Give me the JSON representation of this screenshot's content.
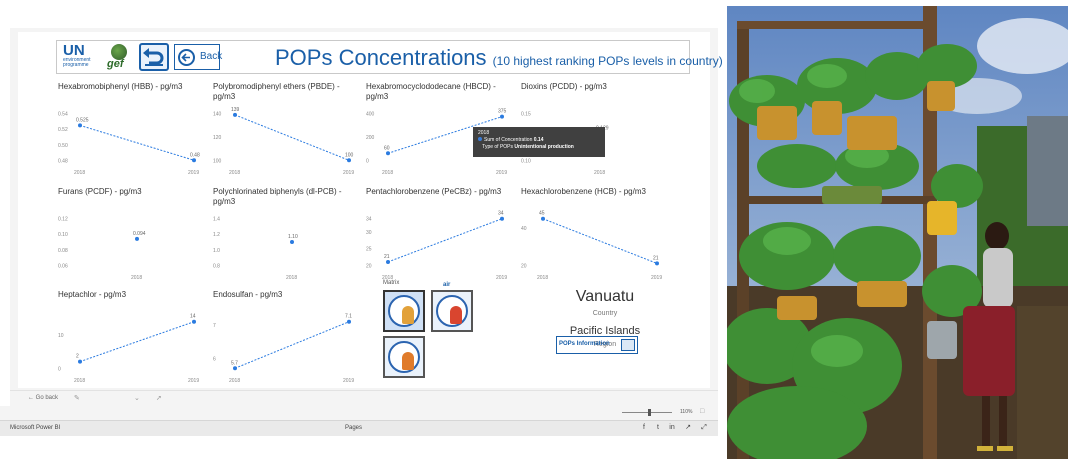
{
  "header": {
    "logo_un": "UN",
    "logo_un_sub1": "environment",
    "logo_un_sub2": "programme",
    "logo_gef": "gef",
    "back_label": "Back",
    "title": "POPs Concentrations",
    "subtitle": "(10 highest ranking POPs levels in country)"
  },
  "cards": [
    {
      "title": "Hexabromobiphenyl (HBB) - pg/m3",
      "yticks": [
        "0.54",
        "0.52",
        "0.50",
        "0.48"
      ],
      "xticks": [
        "2018",
        "2019"
      ],
      "points": [
        {
          "x": "2018",
          "y": 0.525,
          "label": "0.525"
        },
        {
          "x": "2019",
          "y": 0.48,
          "label": "0.48"
        }
      ]
    },
    {
      "title": "Polybromodiphenyl ethers (PBDE) - pg/m3",
      "yticks": [
        "140",
        "120",
        "100"
      ],
      "xticks": [
        "2018",
        "2019"
      ],
      "points": [
        {
          "x": "2018",
          "y": 139,
          "label": "139"
        },
        {
          "x": "2019",
          "y": 100,
          "label": "100"
        }
      ]
    },
    {
      "title": "Hexabromocyclododecane (HBCD) - pg/m3",
      "yticks": [
        "400",
        "200",
        "0"
      ],
      "xticks": [
        "2018",
        "2019"
      ],
      "points": [
        {
          "x": "2018",
          "y": 60,
          "label": "60"
        },
        {
          "x": "2019",
          "y": 375,
          "label": "375"
        }
      ]
    },
    {
      "title": "Dioxins (PCDD) - pg/m3",
      "yticks": [
        "0.15",
        "0.10"
      ],
      "xticks": [
        "2018"
      ],
      "points": [
        {
          "x": "2018",
          "y": 0.129,
          "label": "0.129"
        }
      ]
    },
    {
      "title": "Furans (PCDF) - pg/m3",
      "yticks": [
        "0.12",
        "0.10",
        "0.08",
        "0.06"
      ],
      "xticks": [
        "2018"
      ],
      "points": [
        {
          "x": "2018",
          "y": 0.094,
          "label": "0.094"
        }
      ]
    },
    {
      "title": "Polychlorinated biphenyls (dl-PCB) - pg/m3",
      "yticks": [
        "1.4",
        "1.2",
        "1.0",
        "0.8"
      ],
      "xticks": [
        "2018"
      ],
      "points": [
        {
          "x": "2018",
          "y": 1.1,
          "label": "1.10"
        }
      ]
    },
    {
      "title": "Pentachlorobenzene (PeCBz) - pg/m3",
      "yticks": [
        "34",
        "30",
        "25",
        "20"
      ],
      "xticks": [
        "2018",
        "2019"
      ],
      "points": [
        {
          "x": "2018",
          "y": 21,
          "label": "21"
        },
        {
          "x": "2019",
          "y": 34,
          "label": "34"
        }
      ]
    },
    {
      "title": "Hexachlorobenzene (HCB) - pg/m3",
      "yticks": [
        "40",
        "20"
      ],
      "xticks": [
        "2018",
        "2019"
      ],
      "points": [
        {
          "x": "2018",
          "y": 45,
          "label": "45"
        },
        {
          "x": "2019",
          "y": 21,
          "label": "21"
        }
      ]
    },
    {
      "title": "Heptachlor - pg/m3",
      "yticks": [
        "10",
        "0"
      ],
      "xticks": [
        "2018",
        "2019"
      ],
      "points": [
        {
          "x": "2018",
          "y": 2,
          "label": "2"
        },
        {
          "x": "2019",
          "y": 14,
          "label": "14"
        }
      ]
    },
    {
      "title": "Endosulfan - pg/m3",
      "yticks": [
        "7",
        "6"
      ],
      "xticks": [
        "2018",
        "2019"
      ],
      "points": [
        {
          "x": "2018",
          "y": 5.7,
          "label": "5.7"
        },
        {
          "x": "2019",
          "y": 7.1,
          "label": "7.1"
        }
      ]
    }
  ],
  "tooltip": {
    "year": "2018",
    "row1_key": "Sum of Concentration",
    "row1_val": "0.14",
    "row2_key": "Type of POPs",
    "row2_val": "Unintentional production"
  },
  "matrix": {
    "label": "Matrix",
    "air_label": "air",
    "tile3_caption": "Water"
  },
  "country": {
    "name": "Vanuatu",
    "name_caption": "Country",
    "region": "Pacific Islands",
    "region_caption": "Region",
    "info_button": "POPs Information"
  },
  "toolbar": {
    "go_back": "Go back",
    "zoom": "110%"
  },
  "status": {
    "app_name": "Microsoft Power BI",
    "pages": "Pages"
  },
  "colors": {
    "accent": "#1a5fa8",
    "line": "#2b7be0"
  },
  "chart_data": [
    {
      "type": "line",
      "title": "Hexabromobiphenyl (HBB) - pg/m3",
      "x": [
        "2018",
        "2019"
      ],
      "values": [
        0.525,
        0.48
      ]
    },
    {
      "type": "line",
      "title": "Polybromodiphenyl ethers (PBDE) - pg/m3",
      "x": [
        "2018",
        "2019"
      ],
      "values": [
        139,
        100
      ]
    },
    {
      "type": "line",
      "title": "Hexabromocyclododecane (HBCD) - pg/m3",
      "x": [
        "2018",
        "2019"
      ],
      "values": [
        60,
        375
      ]
    },
    {
      "type": "line",
      "title": "Dioxins (PCDD) - pg/m3",
      "x": [
        "2018"
      ],
      "values": [
        0.129
      ]
    },
    {
      "type": "line",
      "title": "Furans (PCDF) - pg/m3",
      "x": [
        "2018"
      ],
      "values": [
        0.094
      ]
    },
    {
      "type": "line",
      "title": "Polychlorinated biphenyls (dl-PCB) - pg/m3",
      "x": [
        "2018"
      ],
      "values": [
        1.1
      ]
    },
    {
      "type": "line",
      "title": "Pentachlorobenzene (PeCBz) - pg/m3",
      "x": [
        "2018",
        "2019"
      ],
      "values": [
        21,
        34
      ]
    },
    {
      "type": "line",
      "title": "Hexachlorobenzene (HCB) - pg/m3",
      "x": [
        "2018",
        "2019"
      ],
      "values": [
        45,
        21
      ]
    },
    {
      "type": "line",
      "title": "Heptachlor - pg/m3",
      "x": [
        "2018",
        "2019"
      ],
      "values": [
        2,
        14
      ]
    },
    {
      "type": "line",
      "title": "Endosulfan - pg/m3",
      "x": [
        "2018",
        "2019"
      ],
      "values": [
        5.7,
        7.1
      ]
    }
  ]
}
